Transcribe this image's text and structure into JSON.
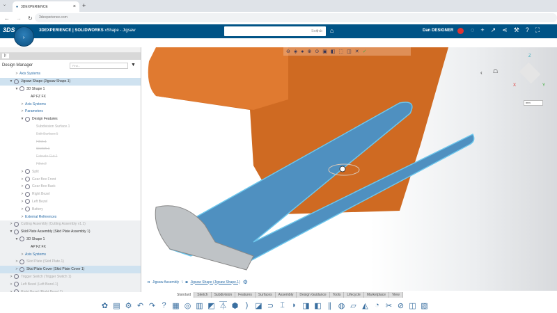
{
  "browser": {
    "tab_title": "3DEXPERIENCE",
    "url": "3dexperience.com"
  },
  "header": {
    "brand": "3DEXPERIENCE | SOLIDWORKS",
    "app": "xShape - Jigsaw",
    "search_placeholder": "Search",
    "user": "Dan DESIGNER",
    "compass_labels": [
      "V",
      "3D",
      "I",
      "V.R"
    ],
    "color": "#005386"
  },
  "panel": {
    "title": "Design Manager",
    "find_placeholder": "Find...",
    "rows": [
      {
        "label": "Axis Systems",
        "style": "blue",
        "indent": 2,
        "caret": ">"
      },
      {
        "label": "Jigsaw Shape (Jigsaw Shape.1)",
        "style": "sel",
        "indent": 1,
        "caret": "▼"
      },
      {
        "label": "3D Shape 1",
        "style": "",
        "indent": 2,
        "caret": "▼"
      },
      {
        "label": "AP  FZ  FX",
        "style": "",
        "indent": 4,
        "caret": ""
      },
      {
        "label": "Axis Systems",
        "style": "blue",
        "indent": 3,
        "caret": ">"
      },
      {
        "label": "Parameters",
        "style": "blue",
        "indent": 3,
        "caret": ">"
      },
      {
        "label": "Design Features",
        "style": "",
        "indent": 3,
        "caret": "▼"
      },
      {
        "label": "Subdivision Surface.1",
        "style": "faded",
        "indent": 5,
        "caret": ""
      },
      {
        "label": "Edit Surface.1",
        "style": "gone",
        "indent": 5,
        "caret": ""
      },
      {
        "label": "Fillet.1",
        "style": "gone",
        "indent": 5,
        "caret": ""
      },
      {
        "label": "Sketch.1",
        "style": "gone",
        "indent": 5,
        "caret": ""
      },
      {
        "label": "Extrude Cut.1",
        "style": "gone",
        "indent": 5,
        "caret": ""
      },
      {
        "label": "Fillet.2",
        "style": "gone",
        "indent": 5,
        "caret": ""
      },
      {
        "label": "Split",
        "style": "faded",
        "indent": 3,
        "caret": ">"
      },
      {
        "label": "Gear Box Front",
        "style": "faded",
        "indent": 3,
        "caret": ">"
      },
      {
        "label": "Gear Box Back",
        "style": "faded",
        "indent": 3,
        "caret": ">"
      },
      {
        "label": "Right Bezel",
        "style": "faded",
        "indent": 3,
        "caret": ">"
      },
      {
        "label": "Left Bezel",
        "style": "faded",
        "indent": 3,
        "caret": ">"
      },
      {
        "label": "Battery",
        "style": "faded",
        "indent": 3,
        "caret": ">"
      },
      {
        "label": "External References",
        "style": "blue",
        "indent": 3,
        "caret": ">"
      },
      {
        "label": "Cutting Assembly (Cutting Assembly v1.1)",
        "style": "gray faded",
        "indent": 1,
        "caret": ">"
      },
      {
        "label": "Skid Plate Assembly (Skid Plate Assembly 1)",
        "style": "gray",
        "indent": 1,
        "caret": "▼"
      },
      {
        "label": "3D Shape 1",
        "style": "gray",
        "indent": 2,
        "caret": "▼"
      },
      {
        "label": "AP  FZ  FX",
        "style": "gray",
        "indent": 4,
        "caret": ""
      },
      {
        "label": "Axis Systems",
        "style": "gray blue",
        "indent": 3,
        "caret": ">"
      },
      {
        "label": "Skid Plate (Skid Plate.1)",
        "style": "gray faded",
        "indent": 2,
        "caret": ">"
      },
      {
        "label": "Skid Plate Cover (Skid Plate Cover 1)",
        "style": "sel",
        "indent": 2,
        "caret": ">"
      },
      {
        "label": "Trigger Switch (Trigger Switch 1)",
        "style": "gray faded",
        "indent": 1,
        "caret": ">"
      },
      {
        "label": "Left Bezel (Left Bezel.1)",
        "style": "gray faded",
        "indent": 1,
        "caret": ">"
      },
      {
        "label": "Right Bezel (Right Bezel.1)",
        "style": "gray faded",
        "indent": 1,
        "caret": ">"
      }
    ]
  },
  "breadcrumb": {
    "root": "Jigsaw Assembly",
    "current": "Jigsaw Shape (Jigsaw Shape.1)"
  },
  "ribbon_tabs": [
    "Standard",
    "Sketch",
    "Subdivision",
    "Features",
    "Surfaces",
    "Assembly",
    "Design Guidance",
    "Tools",
    "Lifecycle",
    "Marketplace",
    "View"
  ],
  "active_tab": "Standard",
  "viewport": {
    "units": "mm",
    "axes": [
      "X",
      "Y",
      "Z"
    ],
    "body_color": "#d2691e",
    "plate_color": "#4a90c8"
  }
}
